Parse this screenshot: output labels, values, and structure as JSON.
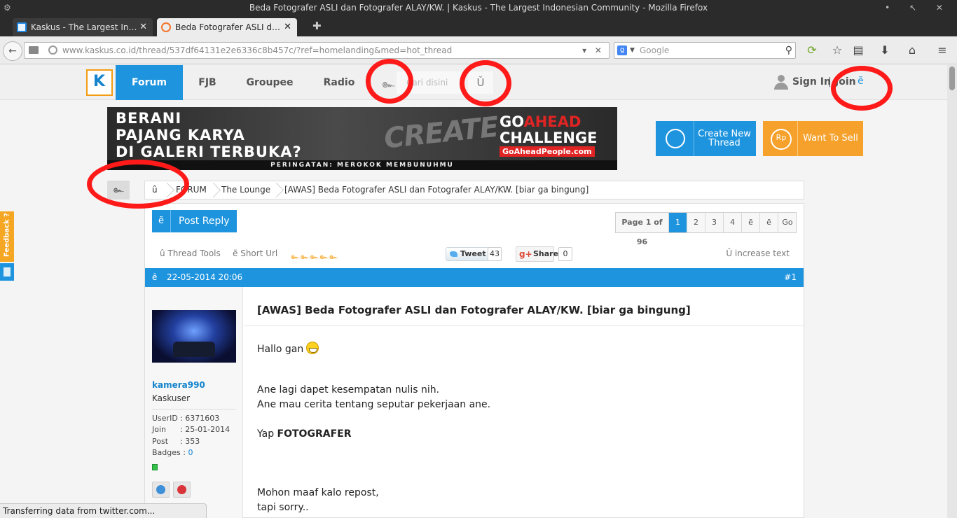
{
  "window": {
    "title": "Beda Fotografer ASLI dan Fotografer ALAY/KW. | Kaskus - The Largest Indonesian Community - Mozilla Firefox",
    "buttons": "• ↖ ✕"
  },
  "tabs": [
    {
      "label": "Kaskus - The Largest Indonesian Community",
      "active": false
    },
    {
      "label": "Beda Fotografer ASLI dan Fotografer ALAY/KW.",
      "active": true
    }
  ],
  "browser": {
    "url": "www.kaskus.co.id/thread/537df64131e2e6336c8b457c/?ref=homelanding&med=hot_thread",
    "search_placeholder": "Google",
    "status_text": "Transferring data from twitter.com..."
  },
  "site_header": {
    "nav": [
      "Forum",
      "FJB",
      "Groupee",
      "Radio"
    ],
    "search_glyph": "๛",
    "search_placeholder": "Cari disini",
    "search_button_glyph": "Ǔ",
    "signin": "Sign In",
    "separator": "|",
    "join": "Join",
    "join_glyph": "ẽ"
  },
  "banner": {
    "headline": [
      "BERANI",
      "PAJANG KARYA",
      "DI GALERI TERBUKA?"
    ],
    "brand_lines": [
      "GO",
      "AHEAD",
      "CHALLENGE"
    ],
    "brand_url": "GoAheadPeople.com",
    "art_text": "CREATE",
    "warning": "PERINGATAN: MEROKOK MEMBUNUHMU"
  },
  "actions": {
    "create_thread": "Create New Thread",
    "want_to_sell": "Want To Sell"
  },
  "breadcrumb": {
    "toggle_glyph": "๛",
    "home_glyph": "û",
    "items": [
      "FORUM",
      "The Lounge",
      "[AWAS] Beda Fotografer ASLI dan Fotografer ALAY/KW. [biar ga bingung]"
    ]
  },
  "thread_controls": {
    "post_reply_glyph": "ẽ",
    "post_reply": "Post Reply",
    "pager_label": "Page 1 of 96",
    "pages": [
      "1",
      "2",
      "3",
      "4",
      "ẽ",
      "ẽ",
      "Go"
    ],
    "current_page": "1",
    "thread_tools": "û Thread Tools",
    "short_url": "ẽ Short Url",
    "rating_stars": "๛๛๛๛๛",
    "tweet": "Tweet",
    "tweet_count": "43",
    "share": "Share",
    "share_count": "0",
    "increase_text": "Ǔ increase text"
  },
  "post": {
    "glyph": "ẽ",
    "date": "22-05-2014 20:06",
    "number": "#1",
    "title": "[AWAS] Beda Fotografer ASLI dan Fotografer ALAY/KW. [biar ga bingung]",
    "body": {
      "greeting": "Hallo gan",
      "line1": "Ane lagi dapet kesempatan nulis nih.",
      "line2": "Ane mau cerita tentang seputar pekerjaan ane.",
      "yap": "Yap ",
      "yap_bold": "FOTOGRAFER",
      "line3": "Mohon maaf kalo repost,",
      "line4": "tapi sorry.."
    }
  },
  "user": {
    "name": "kamera990",
    "rank": "Kaskuser",
    "stats": [
      {
        "key": "UserID",
        "value": ": 6371603"
      },
      {
        "key": "Join",
        "value": ": 25-01-2014"
      },
      {
        "key": "Post",
        "value": ": 353"
      },
      {
        "key": "Badges",
        "value": "0"
      }
    ]
  },
  "feedback": {
    "label": "Feedback ?"
  },
  "colors": {
    "kaskus_blue": "#1e94de",
    "orange": "#f5a12b",
    "annotation_red": "#ff1a1a"
  }
}
